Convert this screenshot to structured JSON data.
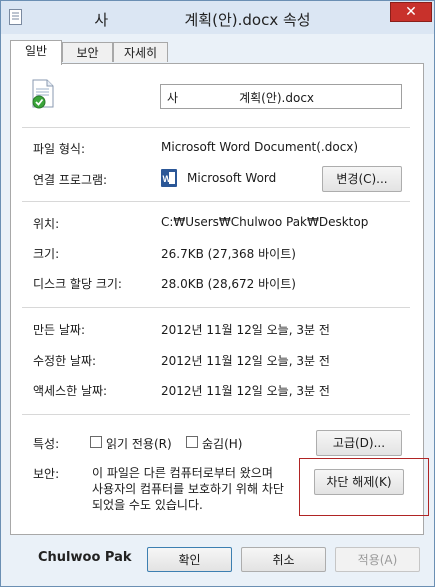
{
  "window": {
    "title": "사                계획(안).docx 속성",
    "close_label": "✕"
  },
  "tabs": [
    {
      "label": "일반"
    },
    {
      "label": "보안"
    },
    {
      "label": "자세히"
    }
  ],
  "general": {
    "filename": "사                계획(안).docx",
    "file_type_label": "파일 형식:",
    "file_type_value": "Microsoft Word Document(.docx)",
    "opens_with_label": "연결 프로그램:",
    "opens_with_value": "Microsoft Word",
    "change_button": "변경(C)...",
    "location_label": "위치:",
    "location_value": "C:₩Users₩Chulwoo Pak₩Desktop",
    "size_label": "크기:",
    "size_value": "26.7KB (27,368 바이트)",
    "size_on_disk_label": "디스크 할당 크기:",
    "size_on_disk_value": "28.0KB (28,672 바이트)",
    "created_label": "만든 날짜:",
    "created_value": "2012년 11월 12일 오늘, 3분 전",
    "modified_label": "수정한 날짜:",
    "modified_value": "2012년 11월 12일 오늘, 3분 전",
    "accessed_label": "액세스한 날짜:",
    "accessed_value": "2012년 11월 12일 오늘, 3분 전",
    "attributes_label": "특성:",
    "readonly_label": "읽기 전용(R)",
    "hidden_label": "숨김(H)",
    "advanced_button": "고급(D)...",
    "security_label": "보안:",
    "security_line1": "이 파일은 다른 컴퓨터로부터 왔으며",
    "security_line2": "사용자의 컴퓨터를 보호하기 위해 차단",
    "security_line3": "되었을 수도 있습니다.",
    "unblock_button": "차단 해제(K)"
  },
  "footer": {
    "user_name": "Chulwoo Pak",
    "ok_button": "확인",
    "cancel_button": "취소",
    "apply_button": "적용(A)"
  }
}
